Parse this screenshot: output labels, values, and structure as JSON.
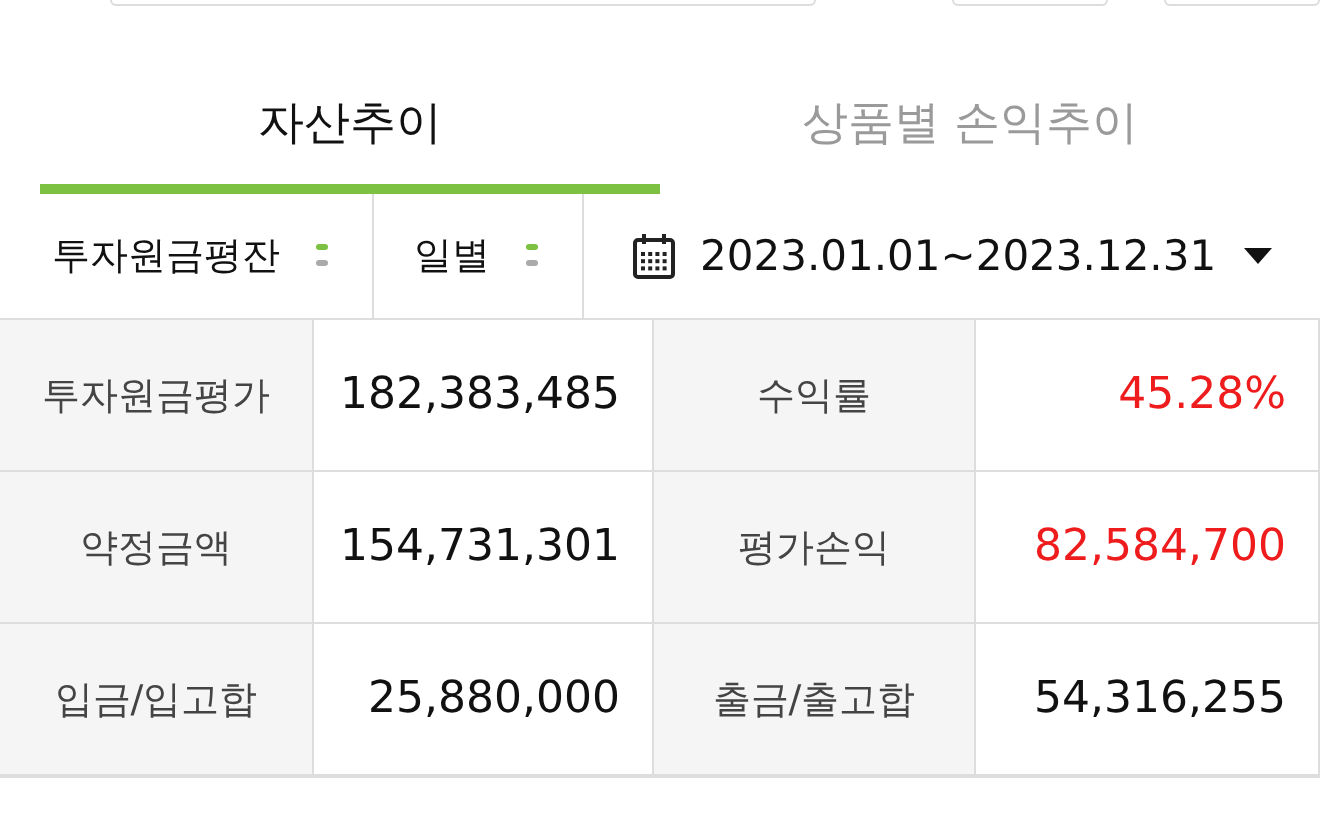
{
  "tabs": [
    {
      "label": "자산추이",
      "selected": true
    },
    {
      "label": "상품별 손익추이",
      "selected": false
    }
  ],
  "filters": {
    "selects": [
      {
        "value": "투자원금평잔"
      },
      {
        "value": "일별"
      }
    ],
    "date_range": "2023.01.01~2023.12.31"
  },
  "summary": [
    {
      "label": "투자원금평가",
      "value": "182,383,485",
      "color": "#111111"
    },
    {
      "label": "수익률",
      "value": "45.28%",
      "color": "#ee1c1c"
    },
    {
      "label": "약정금액",
      "value": "154,731,301",
      "color": "#111111"
    },
    {
      "label": "평가손익",
      "value": "82,584,700",
      "color": "#ee1c1c"
    },
    {
      "label": "입금/입고합",
      "value": "25,880,000",
      "color": "#111111"
    },
    {
      "label": "출금/출고합",
      "value": "54,316,255",
      "color": "#111111"
    }
  ]
}
